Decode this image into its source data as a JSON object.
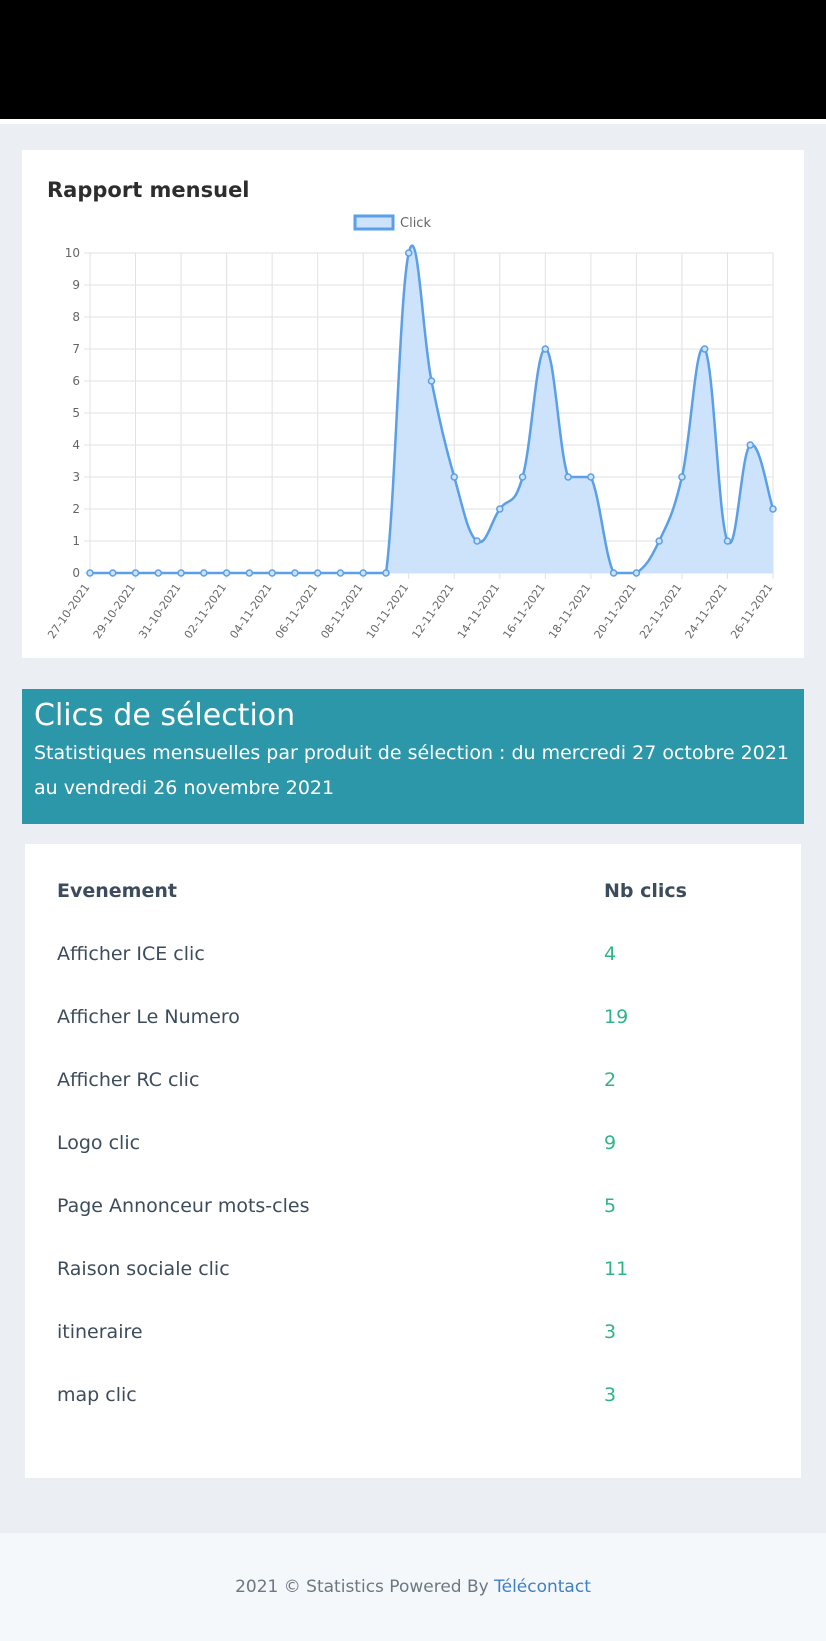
{
  "chart_card": {
    "title": "Rapport mensuel"
  },
  "chart_data": {
    "type": "line",
    "title": "",
    "xlabel": "",
    "ylabel": "",
    "ylim": [
      0,
      10
    ],
    "yticks": [
      0,
      1,
      2,
      3,
      4,
      5,
      6,
      7,
      8,
      9,
      10
    ],
    "x_tick_labels": [
      "27-10-2021",
      "29-10-2021",
      "31-10-2021",
      "02-11-2021",
      "04-11-2021",
      "06-11-2021",
      "08-11-2021",
      "10-11-2021",
      "12-11-2021",
      "14-11-2021",
      "16-11-2021",
      "18-11-2021",
      "20-11-2021",
      "22-11-2021",
      "24-11-2021",
      "26-11-2021"
    ],
    "x": [
      "27-10-2021",
      "28-10-2021",
      "29-10-2021",
      "30-10-2021",
      "31-10-2021",
      "01-11-2021",
      "02-11-2021",
      "03-11-2021",
      "04-11-2021",
      "05-11-2021",
      "06-11-2021",
      "07-11-2021",
      "08-11-2021",
      "09-11-2021",
      "10-11-2021",
      "11-11-2021",
      "12-11-2021",
      "13-11-2021",
      "14-11-2021",
      "15-11-2021",
      "16-11-2021",
      "17-11-2021",
      "18-11-2021",
      "19-11-2021",
      "20-11-2021",
      "21-11-2021",
      "22-11-2021",
      "23-11-2021",
      "24-11-2021",
      "25-11-2021",
      "26-11-2021"
    ],
    "series": [
      {
        "name": "Click",
        "values": [
          0,
          0,
          0,
          0,
          0,
          0,
          0,
          0,
          0,
          0,
          0,
          0,
          0,
          0,
          10,
          6,
          3,
          1,
          2,
          3,
          7,
          3,
          3,
          0,
          0,
          1,
          3,
          7,
          1,
          4,
          2
        ]
      }
    ],
    "legend": "top-center",
    "grid": true,
    "fill": true,
    "colors": {
      "line": "#5a9fe8",
      "fill": "#cde3fb",
      "grid": "#e2e2e2"
    }
  },
  "banner": {
    "title": "Clics de sélection",
    "subtitle": "Statistiques mensuelles par produit de sélection : du mercredi 27 octobre 2021 au vendredi 26 novembre 2021"
  },
  "table": {
    "headers": {
      "event": "Evenement",
      "count": "Nb clics"
    },
    "rows": [
      {
        "event": "Afficher ICE clic",
        "count": "4"
      },
      {
        "event": "Afficher Le Numero",
        "count": "19"
      },
      {
        "event": "Afficher RC clic",
        "count": "2"
      },
      {
        "event": "Logo clic",
        "count": "9"
      },
      {
        "event": "Page Annonceur mots-cles",
        "count": "5"
      },
      {
        "event": "Raison sociale clic",
        "count": "11"
      },
      {
        "event": "itineraire",
        "count": "3"
      },
      {
        "event": "map clic",
        "count": "3"
      }
    ]
  },
  "footer": {
    "text": "2021 © Statistics Powered By",
    "link": "Télécontact"
  }
}
